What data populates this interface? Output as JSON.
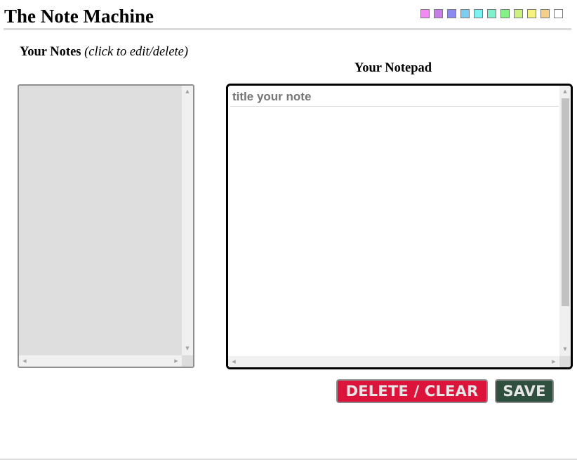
{
  "app": {
    "title": "The Note Machine"
  },
  "color_swatches": [
    {
      "name": "pink",
      "color": "#f18af1"
    },
    {
      "name": "violet",
      "color": "#c97de9"
    },
    {
      "name": "periwinkle",
      "color": "#8a8af0"
    },
    {
      "name": "sky-blue",
      "color": "#7ccdf2"
    },
    {
      "name": "cyan",
      "color": "#7df2f2"
    },
    {
      "name": "aquamarine",
      "color": "#7ff2c9"
    },
    {
      "name": "green",
      "color": "#85f285"
    },
    {
      "name": "lime",
      "color": "#cbf27f"
    },
    {
      "name": "yellow",
      "color": "#f6f27f"
    },
    {
      "name": "peach",
      "color": "#f6cf86"
    },
    {
      "name": "white",
      "color": "#ffffff"
    }
  ],
  "notes_panel": {
    "heading": "Your Notes",
    "heading_note": "(click to edit/delete)",
    "items": []
  },
  "notepad": {
    "heading": "Your Notepad",
    "title_placeholder": "title your note",
    "title_value": "",
    "body_value": ""
  },
  "buttons": {
    "delete_label": "DELETE / CLEAR",
    "save_label": "SAVE"
  },
  "colors": {
    "delete_button": "#dc143c",
    "save_button": "#2f4f3f",
    "notes_background": "#dedede"
  }
}
